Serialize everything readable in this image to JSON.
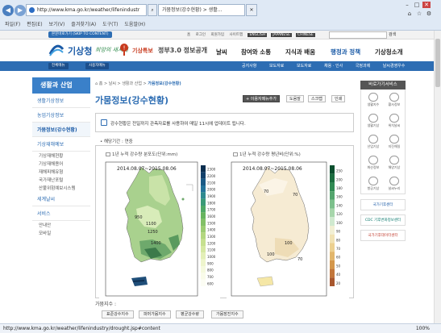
{
  "browser": {
    "url": "http://www.kma.go.kr/weather/lifenindustr",
    "tab_active": "가뭄정보(강수현황) > 생활...",
    "menus": [
      "파일(F)",
      "편집(E)",
      "보기(V)",
      "즐겨찾기(A)",
      "도구(T)",
      "도움말(H)"
    ],
    "status_url": "http://www.kma.go.kr/weather/lifenindustry/drought.jsp#content",
    "zoom": "100%"
  },
  "site": {
    "skip": "본문바로가기 (SKIP TO CONTENT)",
    "top_links": [
      "홈",
      "로그인",
      "회원가입",
      "사이트맵"
    ],
    "langs": [
      "ENGLISH",
      "JAPANESE",
      "CHINESE"
    ],
    "search_label": "검색",
    "logo": "기상청",
    "slogan": "희망의 새시대",
    "alert": "기상특보",
    "open3": "정부3.0 정보공개",
    "gnb": [
      "날씨",
      "참여와 소통",
      "지식과 배움",
      "행정과 정책",
      "기상청소개"
    ],
    "sub_buttons": [
      "전체메뉴",
      "사용자메뉴"
    ],
    "sub_links": [
      "공지사항",
      "보도자료",
      "보도자료",
      "채용 · 인사",
      "국정과제",
      "날씨경영우수"
    ]
  },
  "sidebar": {
    "title": "생활과 산업",
    "items": [
      "생활기상정보",
      "농업기상정보",
      "가뭄정보(강수현황)",
      "기상재해예보"
    ],
    "subs": [
      "기상재해현황",
      "기상재해용어",
      "재해피해유형",
      "국가재난포털",
      "산불위험예보시스템"
    ],
    "more": [
      "세계날씨",
      "서비스",
      "안내안",
      "모바일"
    ]
  },
  "main": {
    "crumb": [
      "홈",
      "날씨",
      "생활과 산업",
      "가뭄정보(강수현황)"
    ],
    "title": "가뭄정보(강수현황)",
    "tools": [
      "+ 이용자메뉴추가",
      "도움말",
      "스크랩",
      "인쇄"
    ],
    "notice": "강수현황은 전일까지 관측자료를 사용하여 매일 11시에 업데이트 됩니다.",
    "period": "• 해당기간 : 연중",
    "map1_label": "1년 누적 강수량 분포도(단위:mm)",
    "map2_label": "1년 누적 강수량 평년비(단위:%)",
    "map_date": "2014.08.07~2015.08.06",
    "contours1": [
      "950",
      "1100",
      "1250",
      "1400"
    ],
    "contours2": [
      "70",
      "70",
      "100",
      "100",
      "70"
    ],
    "legend1": [
      "2300",
      "2200",
      "2100",
      "2000",
      "1900",
      "1800",
      "1700",
      "1600",
      "1500",
      "1400",
      "1300",
      "1200",
      "1100",
      "1000",
      "900",
      "800",
      "700",
      "600"
    ],
    "legend2": [
      "250",
      "200",
      "180",
      "160",
      "140",
      "120",
      "100",
      "90",
      "80",
      "70",
      "60",
      "50",
      "40",
      "20"
    ],
    "bottom_line": "가뭄지수 :",
    "bottom_tabs": [
      "표준강수지수",
      "파머가뭄지수",
      "평균강수량",
      "가뭄장진지수"
    ]
  },
  "rail": {
    "title": "바로가기서비스",
    "items": [
      "생활지수",
      "황사정보",
      "생활기상",
      "위치날씨",
      "산업기상",
      "지진해일",
      "화산정보",
      "해양기상",
      "항공기상",
      "날씨누리",
      "날씨누리",
      "검색서비스"
    ],
    "banners": [
      "국가기후센터",
      "CDC 기후변화정보센터",
      "국가기후데이터센터"
    ]
  }
}
